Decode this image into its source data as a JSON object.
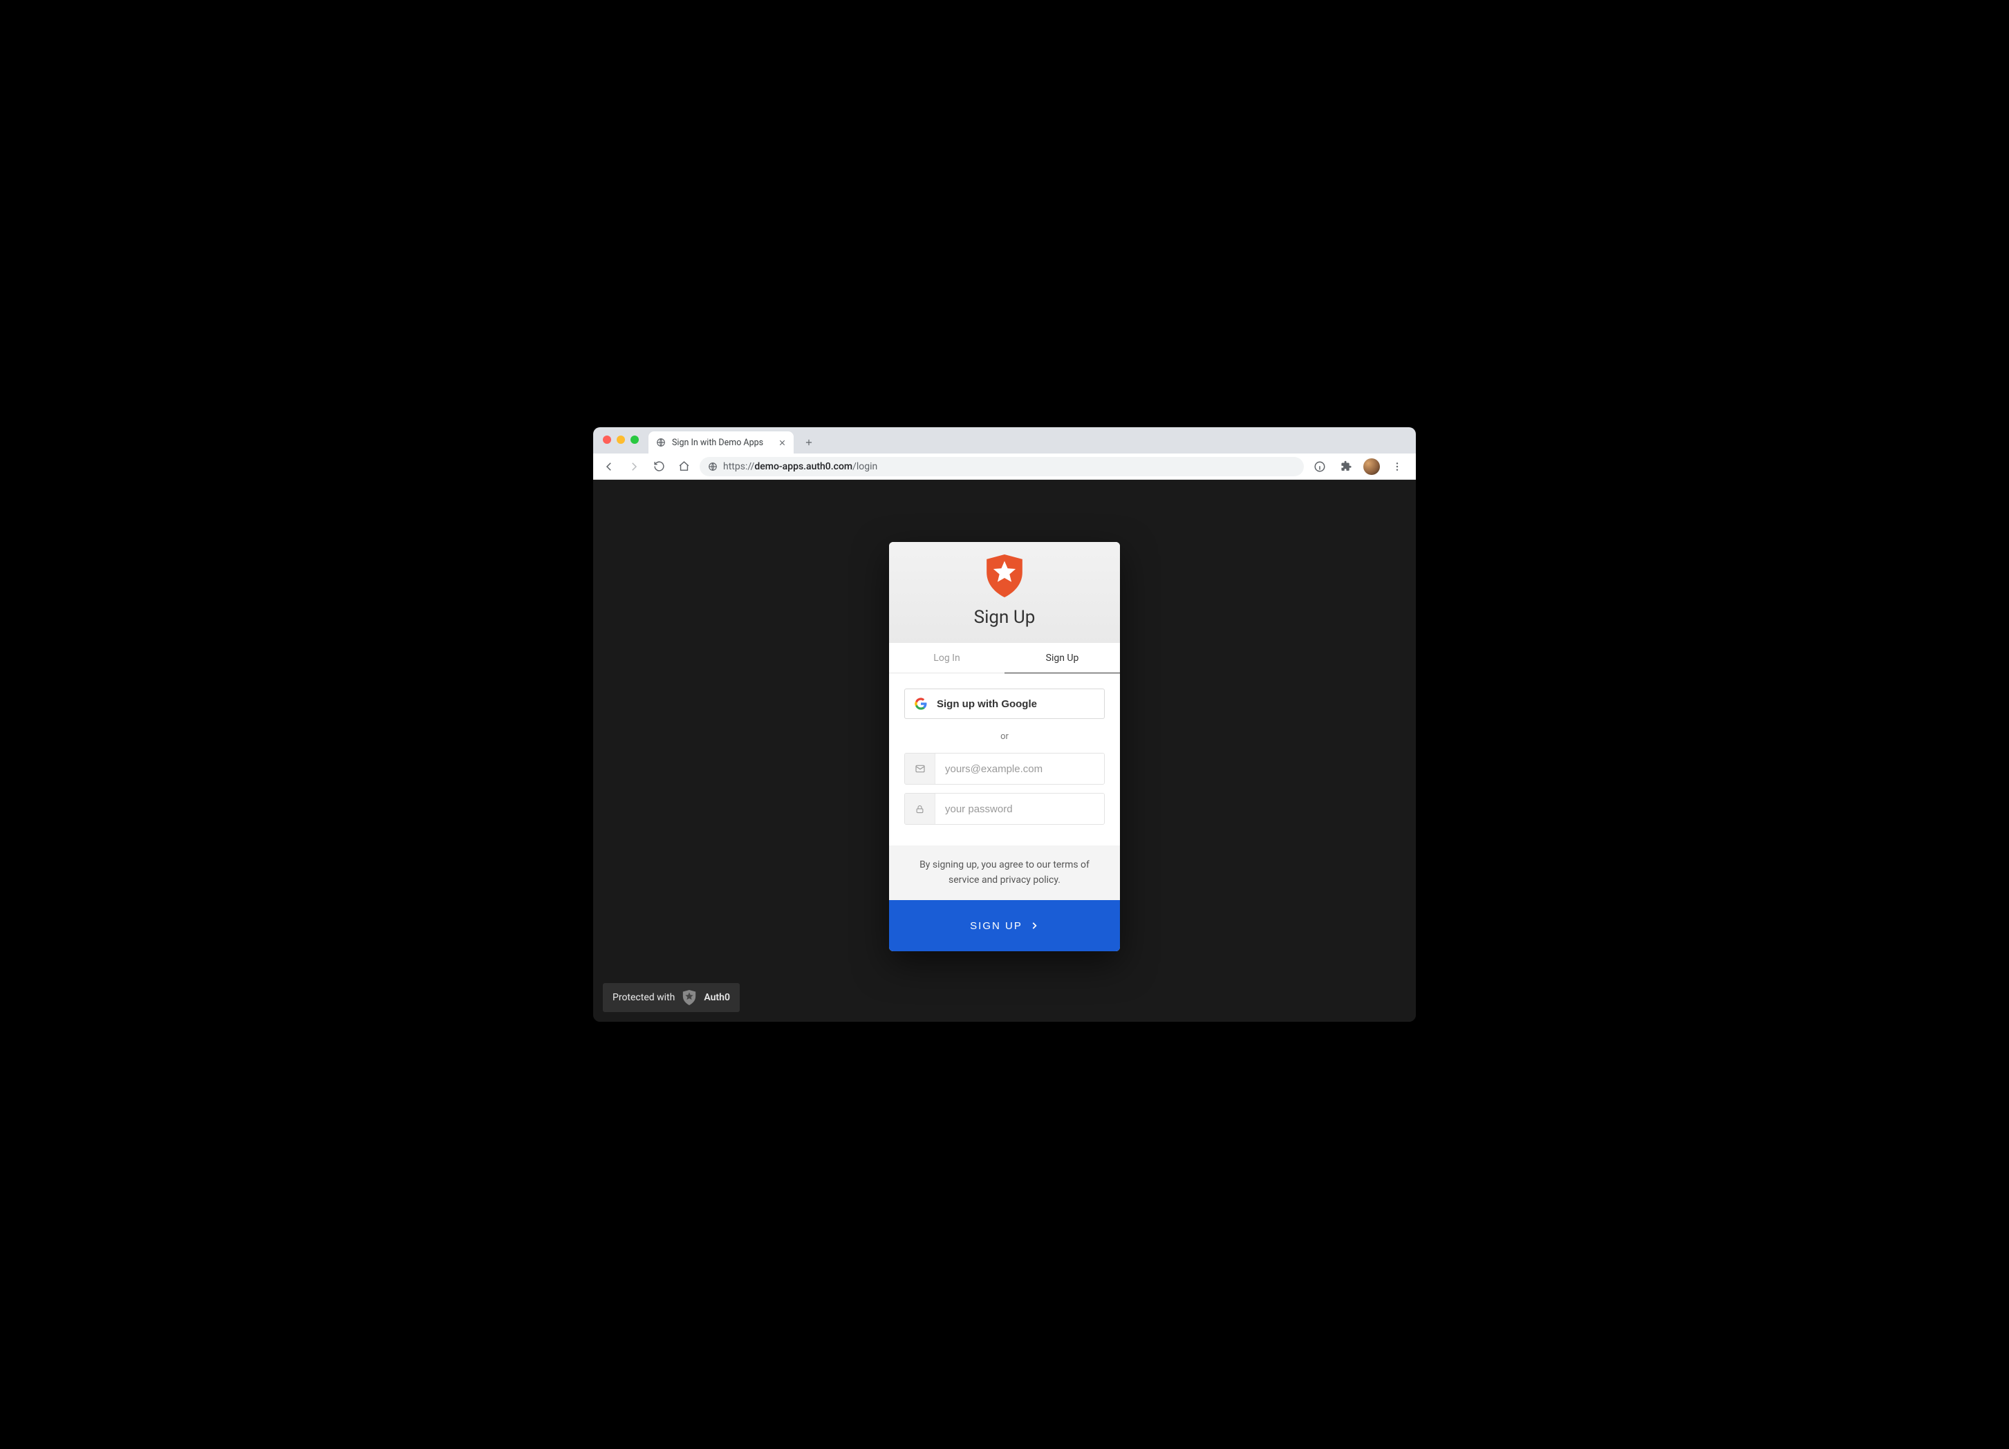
{
  "browser": {
    "tab_title": "Sign In with Demo Apps",
    "url_proto": "https://",
    "url_host": "demo-apps.auth0.com",
    "url_path": "/login"
  },
  "lock": {
    "title": "Sign Up",
    "tabs": {
      "login": "Log In",
      "signup": "Sign Up"
    },
    "active_tab": "signup",
    "google_label": "Sign up with Google",
    "divider": "or",
    "email_placeholder": "yours@example.com",
    "password_placeholder": "your password",
    "terms": "By signing up, you agree to our terms of service and privacy policy.",
    "submit": "SIGN UP"
  },
  "badge": {
    "prefix": "Protected with",
    "brand": "Auth0"
  },
  "colors": {
    "accent": "#1a5dd6",
    "logo": "#e8542b"
  }
}
